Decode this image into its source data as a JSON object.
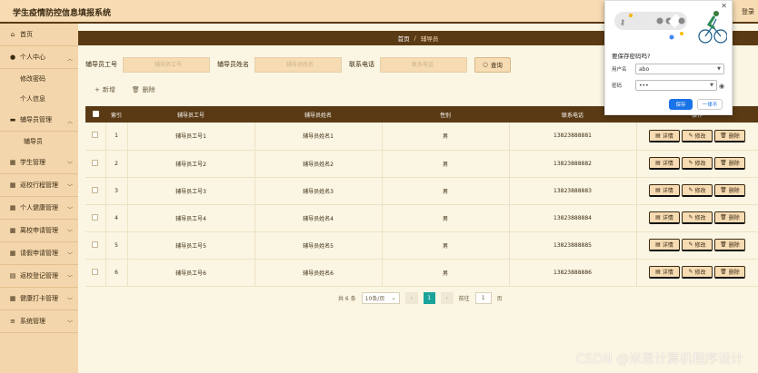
{
  "header": {
    "title": "学生疫情防控信息填报系统",
    "logout": "登录"
  },
  "sidebar": {
    "home": "首页",
    "personal_center": "个人中心",
    "personal_sub": [
      "修改密码",
      "个人信息"
    ],
    "counselor_mgmt": "辅导员管理",
    "counselor_sub": [
      "辅导员"
    ],
    "items": [
      "学生管理",
      "返校行程管理",
      "个人健康管理",
      "离校申请管理",
      "请假申请管理",
      "返校登记管理",
      "健康打卡管理",
      "系统管理"
    ]
  },
  "breadcrumb": {
    "home": "首页",
    "separator": "/",
    "current": "辅导员"
  },
  "search": {
    "labels": [
      "辅导员工号",
      "辅导员姓名",
      "联系电话"
    ],
    "placeholders": [
      "辅导员工号",
      "辅导员姓名",
      "联系电话"
    ],
    "button": "查询"
  },
  "actions": {
    "add": "新增",
    "delete": "删除"
  },
  "table": {
    "headers": [
      "索引",
      "辅导员工号",
      "辅导员姓名",
      "性别",
      "联系电话",
      "操作"
    ],
    "rows": [
      {
        "index": "1",
        "id": "辅导员工号1",
        "name": "辅导员姓名1",
        "gender": "男",
        "phone": "13823888881"
      },
      {
        "index": "2",
        "id": "辅导员工号2",
        "name": "辅导员姓名2",
        "gender": "男",
        "phone": "13823888882"
      },
      {
        "index": "3",
        "id": "辅导员工号3",
        "name": "辅导员姓名3",
        "gender": "男",
        "phone": "13823888883"
      },
      {
        "index": "4",
        "id": "辅导员工号4",
        "name": "辅导员姓名4",
        "gender": "男",
        "phone": "13823888884"
      },
      {
        "index": "5",
        "id": "辅导员工号5",
        "name": "辅导员姓名5",
        "gender": "男",
        "phone": "13823888885"
      },
      {
        "index": "6",
        "id": "辅导员工号6",
        "name": "辅导员姓名6",
        "gender": "男",
        "phone": "13823888886"
      }
    ],
    "op_labels": {
      "detail": "详情",
      "edit": "修改",
      "delete": "删除"
    }
  },
  "pagination": {
    "total": "共 6 条",
    "page_size": "10条/页",
    "current_page": "1",
    "goto_label": "前往",
    "goto_value": "1",
    "page_unit": "页"
  },
  "password_popup": {
    "title": "要保存密码吗?",
    "username_label": "用户名",
    "username_value": "abo",
    "password_label": "密码",
    "password_value": "•••",
    "save": "保存",
    "never": "一律不"
  },
  "watermark": "CSDN @米恩计算机程序设计",
  "colors": {
    "header_bg": "#f6dbb3",
    "sidebar_bg": "#f3d6ac",
    "accent_dark": "#5a3a14",
    "content_bg": "#fbf6e3",
    "page_active": "#1aa39a",
    "popup_primary": "#1a73e8"
  }
}
